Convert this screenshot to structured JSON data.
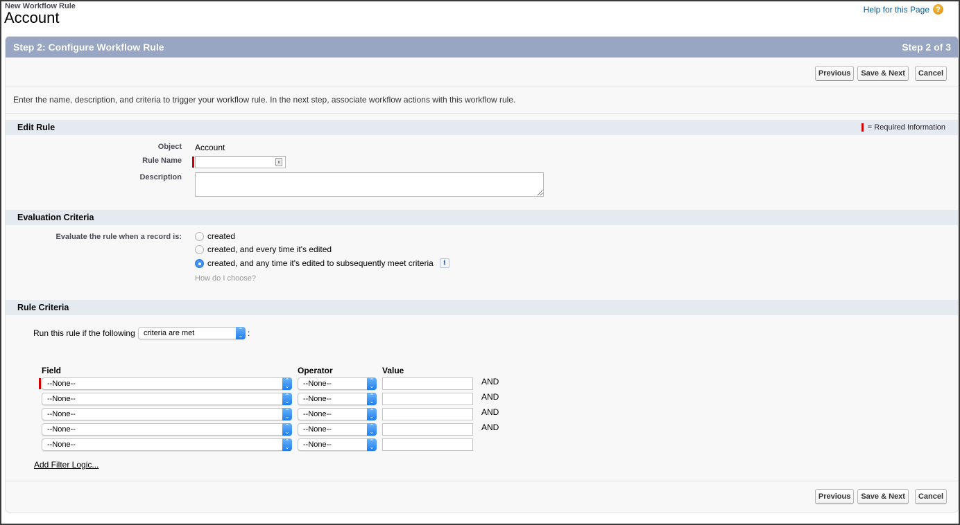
{
  "page": {
    "subtitle": "New Workflow Rule",
    "title": "Account",
    "help_link": "Help for this Page",
    "help_icon": "?"
  },
  "step_header": {
    "title": "Step 2: Configure Workflow Rule",
    "step": "Step 2 of 3"
  },
  "buttons": {
    "previous": "Previous",
    "save_next": "Save & Next",
    "cancel": "Cancel"
  },
  "intro": "Enter the name, description, and criteria to trigger your workflow rule. In the next step, associate workflow actions with this workflow rule.",
  "edit_rule": {
    "section_title": "Edit Rule",
    "required_legend": "= Required Information",
    "object_label": "Object",
    "object_value": "Account",
    "rule_name_label": "Rule Name",
    "rule_name_value": "",
    "description_label": "Description",
    "description_value": ""
  },
  "evaluation": {
    "section_title": "Evaluation Criteria",
    "label": "Evaluate the rule when a record is:",
    "options": [
      {
        "label": "created",
        "checked": false
      },
      {
        "label": "created, and every time it's edited",
        "checked": false
      },
      {
        "label": "created, and any time it's edited to subsequently meet criteria",
        "checked": true
      }
    ],
    "info_icon": "i",
    "how_link": "How do I choose?"
  },
  "rule_criteria": {
    "section_title": "Rule Criteria",
    "run_text": "Run this rule if the following",
    "run_select": "criteria are met",
    "colon": ":",
    "columns": {
      "field": "Field",
      "operator": "Operator",
      "value": "Value"
    },
    "rows": [
      {
        "field": "--None--",
        "operator": "--None--",
        "value": "",
        "conjunction": "AND"
      },
      {
        "field": "--None--",
        "operator": "--None--",
        "value": "",
        "conjunction": "AND"
      },
      {
        "field": "--None--",
        "operator": "--None--",
        "value": "",
        "conjunction": "AND"
      },
      {
        "field": "--None--",
        "operator": "--None--",
        "value": "",
        "conjunction": "AND"
      },
      {
        "field": "--None--",
        "operator": "--None--",
        "value": "",
        "conjunction": ""
      }
    ],
    "add_filter_logic": "Add Filter Logic..."
  },
  "colors": {
    "header_bar": "#98a6c3",
    "section_bar": "#e5e9f0",
    "required": "#cc0000",
    "link": "#015ba7",
    "select_arrow": "#1d7ef1"
  }
}
